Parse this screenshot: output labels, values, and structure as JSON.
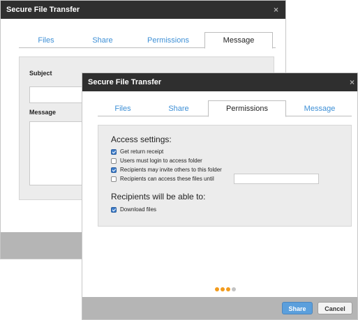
{
  "back_window": {
    "title": "Secure File Transfer",
    "close_glyph": "×",
    "tabs": [
      {
        "label": "Files",
        "active": false
      },
      {
        "label": "Share",
        "active": false
      },
      {
        "label": "Permissions",
        "active": false
      },
      {
        "label": "Message",
        "active": true
      }
    ],
    "subject_label": "Subject",
    "subject_value": "",
    "message_label": "Message",
    "message_value": ""
  },
  "front_window": {
    "title": "Secure File Transfer",
    "close_glyph": "×",
    "tabs": [
      {
        "label": "Files",
        "active": false
      },
      {
        "label": "Share",
        "active": false
      },
      {
        "label": "Permissions",
        "active": true
      },
      {
        "label": "Message",
        "active": false
      }
    ],
    "access_heading": "Access settings:",
    "options": [
      {
        "label": "Get return receipt",
        "checked": true
      },
      {
        "label": "Users must login to access folder",
        "checked": false
      },
      {
        "label": "Recipients may invite others to this folder",
        "checked": true
      },
      {
        "label": "Recipients can access these files until",
        "checked": false
      }
    ],
    "expiry_date_value": "",
    "recipients_heading": "Recipients will be able to:",
    "recipient_options": [
      {
        "label": "Download files",
        "checked": true
      }
    ],
    "progress": {
      "total_steps": 4,
      "completed_steps": 3
    },
    "buttons": {
      "share_label": "Share",
      "cancel_label": "Cancel"
    }
  },
  "colors": {
    "titlebar": "#2f2f2f",
    "tab_link": "#3d8fd6",
    "accent_orange": "#f29b1d",
    "share_button": "#5b9fdc",
    "footer": "#b5b5b5"
  }
}
